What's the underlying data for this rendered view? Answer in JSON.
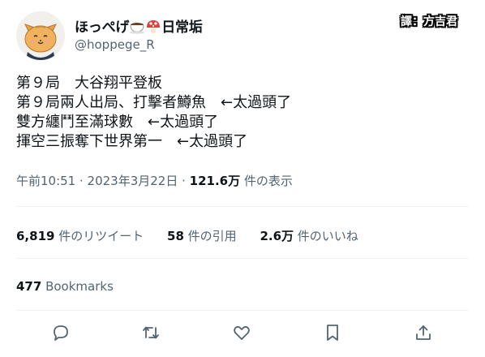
{
  "author": {
    "display_name": "ほっぺげ",
    "display_name_suffix": "日常垢",
    "handle": "@hoppege_R",
    "avatar_icon": "cat-avatar-icon"
  },
  "watermark": "譯：方吉君",
  "tweet": {
    "lines": [
      "第９局　大谷翔平登板",
      "第９局兩人出局、打擊者鱒魚　←太過頭了",
      "雙方纏鬥至滿球數　←太過頭了",
      "揮空三振奪下世界第一　←太過頭了"
    ]
  },
  "meta": {
    "time": "午前10:51",
    "separator": " · ",
    "date": "2023年3月22日",
    "views_count": "121.6万",
    "views_label": " 件の表示"
  },
  "stats": {
    "retweets_count": "6,819",
    "retweets_label": " 件のリツイート",
    "quotes_count": "58",
    "quotes_label": " 件の引用",
    "likes_count": "2.6万",
    "likes_label": " 件のいいね"
  },
  "bookmarks": {
    "count": "477",
    "label": " Bookmarks"
  },
  "actions": {
    "icons": [
      "reply-icon",
      "retweet-icon",
      "like-icon",
      "bookmark-icon",
      "share-icon"
    ]
  },
  "colors": {
    "text": "#0f1419",
    "secondary": "#536471",
    "divider": "#eff3f4"
  }
}
